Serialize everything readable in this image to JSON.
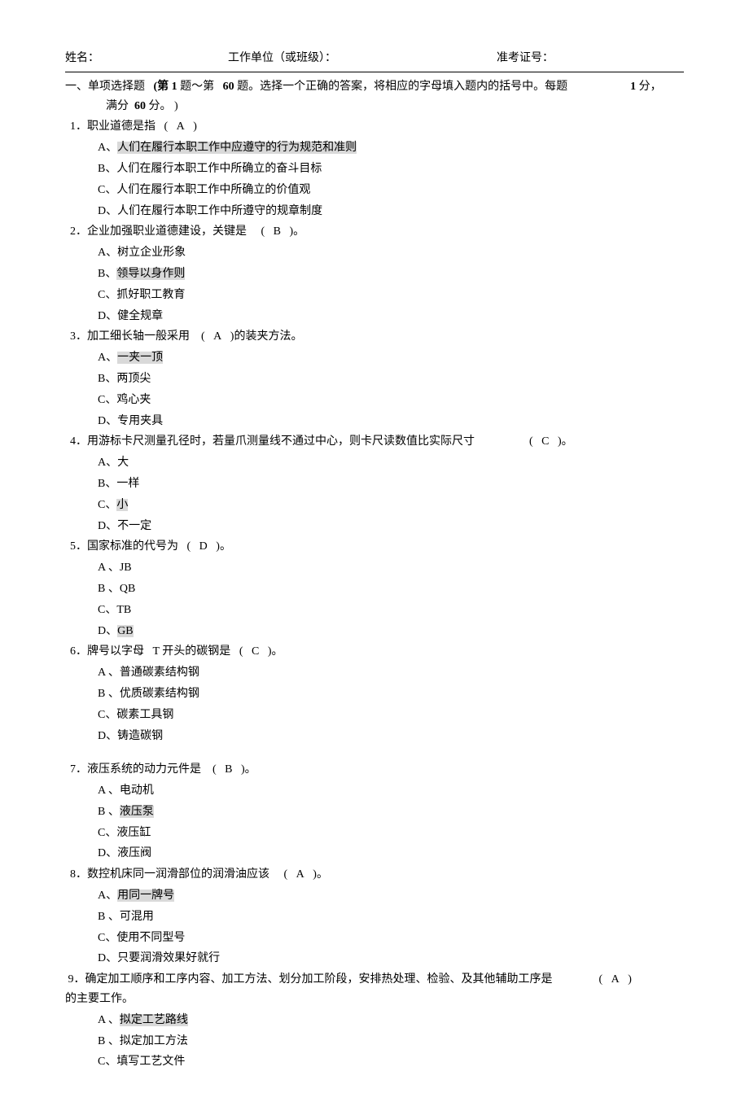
{
  "header": {
    "name_label": "姓名：",
    "unit_label": "工作单位（或班级）：",
    "exam_no_label": "准考证号："
  },
  "section": {
    "line1_a": "一、单项选择题",
    "line1_b": "(第",
    "line1_c": "1",
    "line1_d": "题～第",
    "line1_e": "60",
    "line1_f": "题。选择一个正确的答案，将相应的字母填入题内的括号中。每题",
    "line1_g": "1",
    "line1_h": "分，",
    "line2_a": "满分",
    "line2_b": "60",
    "line2_c": "分。 )"
  },
  "q1": {
    "stem_a": "1．职业道德是指",
    "stem_b": "(",
    "stem_c": "A",
    "stem_d": ")",
    "a_pre": "A、",
    "a_hl": "人们在履行本职工作中应遵守的行为规范和准则",
    "b": "B、人们在履行本职工作中所确立的奋斗目标",
    "c": "C、人们在履行本职工作中所确立的价值观",
    "d": "D、人们在履行本职工作中所遵守的规章制度"
  },
  "q2": {
    "stem_a": "2．企业加强职业道德建设，关键是",
    "stem_b": "(",
    "stem_c": "B",
    "stem_d": ")。",
    "a": "A、树立企业形象",
    "b_pre": "B、",
    "b_hl": "领导以身作则",
    "c": "C、抓好职工教育",
    "d": "D、健全规章"
  },
  "q3": {
    "stem_a": "3．加工细长轴一般采用",
    "stem_b": "(",
    "stem_c": "A",
    "stem_d": ")的装夹方法。",
    "a_pre": "A、",
    "a_hl": "一夹一顶",
    "b": "B、两顶尖",
    "c": "C、鸡心夹",
    "d": "D、专用夹具"
  },
  "q4": {
    "stem_a": "4．用游标卡尺测量孔径时，若量爪测量线不通过中心，则卡尺读数值比实际尺寸",
    "stem_b": "(",
    "stem_c": "C",
    "stem_d": ")。",
    "a": "A、大",
    "b": "B、一样",
    "c_pre": "C、",
    "c_hl": "小",
    "d": "D、不一定"
  },
  "q5": {
    "stem_a": "5．国家标准的代号为",
    "stem_b": "(",
    "stem_c": "D",
    "stem_d": ")。",
    "a": "A 、JB",
    "b": "B 、QB",
    "c": "C、TB",
    "d_pre": "D、",
    "d_hl": "GB"
  },
  "q6": {
    "stem_a": "6．牌号以字母",
    "stem_b": "T 开头的碳钢是",
    "stem_c": "(",
    "stem_d": "C",
    "stem_e": ")。",
    "a": "A 、普通碳素结构钢",
    "b": "B 、优质碳素结构钢",
    "c": "C、碳素工具钢",
    "d": "D、铸造碳钢"
  },
  "q7": {
    "stem_a": "7．液压系统的动力元件是",
    "stem_b": "(",
    "stem_c": "B",
    "stem_d": ")。",
    "a": "A 、电动机",
    "b_pre": "B 、",
    "b_hl": "液压泵",
    "c": "C、液压缸",
    "d": "D、液压阀"
  },
  "q8": {
    "stem_a": "8．数控机床同一润滑部位的润滑油应该",
    "stem_b": "(",
    "stem_c": "A",
    "stem_d": ")。",
    "a_pre": "A、",
    "a_hl": "用同一牌号",
    "b": "B 、可混用",
    "c": "C、使用不同型号",
    "d": "D、只要润滑效果好就行"
  },
  "q9": {
    "stem_a": "9．确定加工顺序和工序内容、加工方法、划分加工阶段，安排热处理、检验、及其他辅助工序是",
    "stem_b": "(",
    "stem_c": "A",
    "stem_d": ")",
    "tail": "的主要工作。",
    "a_pre": "A 、",
    "a_hl": "拟定工艺路线",
    "b": "B 、拟定加工方法",
    "c": "C、填写工艺文件"
  }
}
